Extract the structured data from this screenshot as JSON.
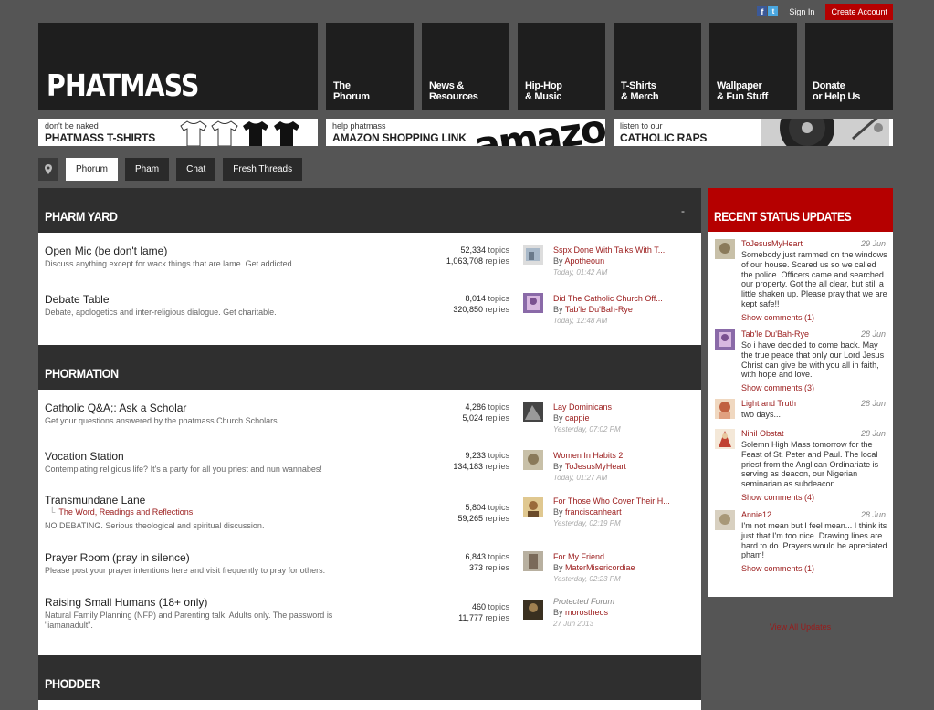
{
  "topbar": {
    "signin": "Sign In",
    "create": "Create Account",
    "fb": "f",
    "tw": "t"
  },
  "site": {
    "logo": "PHATMASS"
  },
  "nav": [
    "The\nPhorum",
    "News &\nResources",
    "Hip-Hop\n& Music",
    "T-Shirts\n& Merch",
    "Wallpaper\n& Fun Stuff",
    "Donate\nor Help Us"
  ],
  "banners": [
    {
      "small": "don't be naked",
      "big": "PHATMASS T-SHIRTS"
    },
    {
      "small": "help phatmass",
      "big": "AMAZON SHOPPING LINK",
      "art": "amazon"
    },
    {
      "small": "listen to our",
      "big": "CATHOLIC RAPS"
    }
  ],
  "subnav": [
    "Phorum",
    "Pham",
    "Chat",
    "Fresh Threads"
  ],
  "categories": [
    {
      "title": "PHARM YARD",
      "collapse": "-",
      "forums": [
        {
          "name": "Open Mic (be don't lame)",
          "desc": "Discuss anything except for wack things that are lame. Get addicted.",
          "topics": "52,334",
          "replies": "1,063,708",
          "last_title": "Sspx Done With Talks With T...",
          "last_by": "Apotheoun",
          "last_time": "Today, 01:42 AM"
        },
        {
          "name": "Debate Table",
          "desc": "Debate, apologetics and inter-religious dialogue. Get charitable.",
          "topics": "8,014",
          "replies": "320,850",
          "last_title": "Did The Catholic Church Off...",
          "last_by": "Tab'le Du'Bah-Rye",
          "last_time": "Today, 12:48 AM"
        }
      ]
    },
    {
      "title": "PHORMATION",
      "forums": [
        {
          "name": "Catholic Q&A;: Ask a Scholar",
          "desc": "Get your questions answered by the phatmass Church Scholars.",
          "topics": "4,286",
          "replies": "5,024",
          "last_title": "Lay Dominicans",
          "last_by": "cappie",
          "last_time": "Yesterday, 07:02 PM"
        },
        {
          "name": "Vocation Station",
          "desc": "Contemplating religious life? It's a party for all you priest and nun wannabes!",
          "topics": "9,233",
          "replies": "134,183",
          "last_title": "Women In Habits 2",
          "last_by": "ToJesusMyHeart",
          "last_time": "Today, 01:27 AM"
        },
        {
          "name": "Transmundane Lane",
          "sub": "The Word, Readings and Reflections.",
          "desc": "NO DEBATING. Serious theological and spiritual discussion.",
          "topics": "5,804",
          "replies": "59,265",
          "last_title": "For Those Who Cover Their H...",
          "last_by": "franciscanheart",
          "last_time": "Yesterday, 02:19 PM"
        },
        {
          "name": "Prayer Room (pray in silence)",
          "desc": "Please post your prayer intentions here and visit frequently to pray for others.",
          "topics": "6,843",
          "replies": "373",
          "last_title": "For My Friend",
          "last_by": "MaterMisericordiae",
          "last_time": "Yesterday, 02:23 PM"
        },
        {
          "name": "Raising Small Humans (18+ only)",
          "desc": "Natural Family Planning (NFP) and Parenting talk. Adults only. The password is",
          "desc2": "\"iamanadult\".",
          "topics": "460",
          "replies": "11,777",
          "last_title": "Protected Forum",
          "last_by": "morostheos",
          "last_time": "27 Jun 2013"
        }
      ]
    },
    {
      "title": "PHODDER"
    }
  ],
  "labels": {
    "topics": "topics",
    "replies": "replies",
    "by": "By"
  },
  "sidebar": {
    "title": "RECENT STATUS UPDATES",
    "updates": [
      {
        "name": "ToJesusMyHeart",
        "date": "29 Jun",
        "text": "Somebody just rammed on the windows of our house. Scared us so we called the police. Officers came and searched our property. Got the all clear, but still a little shaken up. Please pray that we are kept safe!!",
        "show": "Show comments (1)"
      },
      {
        "name": "Tab'le Du'Bah-Rye",
        "date": "28 Jun",
        "text": "So i have decided to come back. May the true peace that only our Lord Jesus Christ can give be with you all in faith, with hope and love.",
        "show": "Show comments (3)"
      },
      {
        "name": "Light and Truth",
        "date": "28 Jun",
        "text": "two days...",
        "show": ""
      },
      {
        "name": "Nihil Obstat",
        "date": "28 Jun",
        "text": "Solemn High Mass tomorrow for the Feast of St. Peter and Paul. The local priest from the Anglican Ordinariate is serving as deacon, our Nigerian seminarian as subdeacon.",
        "show": "Show comments (4)"
      },
      {
        "name": "Annie12",
        "date": "28 Jun",
        "text": "I'm not mean but I feel mean... I think its just that I'm too nice. Drawing lines are hard to do. Prayers would be apreciated pham!",
        "show": "Show comments (1)"
      }
    ],
    "view_all": "View All Updates"
  },
  "colors": {
    "accent": "#b50000",
    "link": "#9a1a1a",
    "tile": "#1e1e1e",
    "page": "#555555"
  },
  "icons": {
    "location": "map-pin-icon"
  }
}
